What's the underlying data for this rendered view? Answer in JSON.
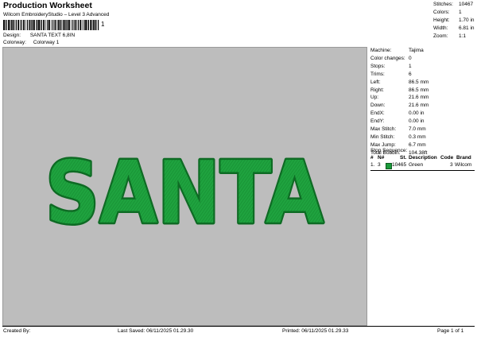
{
  "header": {
    "title": "Production Worksheet",
    "subtitle": "Wilcom EmbroideryStudio – Level 3 Advanced",
    "barcode_suffix": "1"
  },
  "meta": {
    "design_label": "Design:",
    "design_value": "SANTA TEXT 6,8IN",
    "colorway_label": "Colorway:",
    "colorway_value": "Colorway 1"
  },
  "stats": [
    {
      "label": "Stitches:",
      "value": "10467"
    },
    {
      "label": "Colors:",
      "value": "1"
    },
    {
      "label": "Height:",
      "value": "1.70 in"
    },
    {
      "label": "Width:",
      "value": "6.81 in"
    },
    {
      "label": "Zoom:",
      "value": "1:1"
    }
  ],
  "design": {
    "text": "SANTA",
    "fill_color": "#1fa33f",
    "stitch_color": "#158a30",
    "outline_color": "#0e6b24",
    "background_color": "#bdbdbd"
  },
  "spec": [
    {
      "label": "Machine:",
      "value": "Tajima"
    },
    {
      "label": "Color changes:",
      "value": "0"
    },
    {
      "label": "Stops:",
      "value": "1"
    },
    {
      "label": "Trims:",
      "value": "6"
    },
    {
      "label": "Left:",
      "value": "86.5 mm"
    },
    {
      "label": "Right:",
      "value": "86.5 mm"
    },
    {
      "label": "Up:",
      "value": "21.6 mm"
    },
    {
      "label": "Down:",
      "value": "21.6 mm"
    },
    {
      "label": "EndX:",
      "value": "0.00 in"
    },
    {
      "label": "EndY:",
      "value": "0.00 in"
    },
    {
      "label": "Max Stitch:",
      "value": "7.0 mm"
    },
    {
      "label": "Min Stitch:",
      "value": "0.3 mm"
    },
    {
      "label": "Max Jump:",
      "value": "6.7 mm"
    },
    {
      "label": "Total Bobbin:",
      "value": "104.38ft"
    }
  ],
  "stop_sequence": {
    "title": "Stop Sequence:",
    "columns": [
      "#",
      "N#",
      "St.",
      "Description",
      "Code",
      "Brand"
    ],
    "rows": [
      {
        "index": "1.",
        "needle": "3",
        "stitches": "10465",
        "description": "Green",
        "code": "3",
        "brand": "Wilcom",
        "color": "#1a9a3a"
      }
    ]
  },
  "footer": {
    "created_by": "Created By:",
    "last_saved": "Last Saved: 06/11/2025 01.29.30",
    "printed": "Printed: 06/11/2025 01.29.33",
    "page": "Page 1 of 1"
  }
}
